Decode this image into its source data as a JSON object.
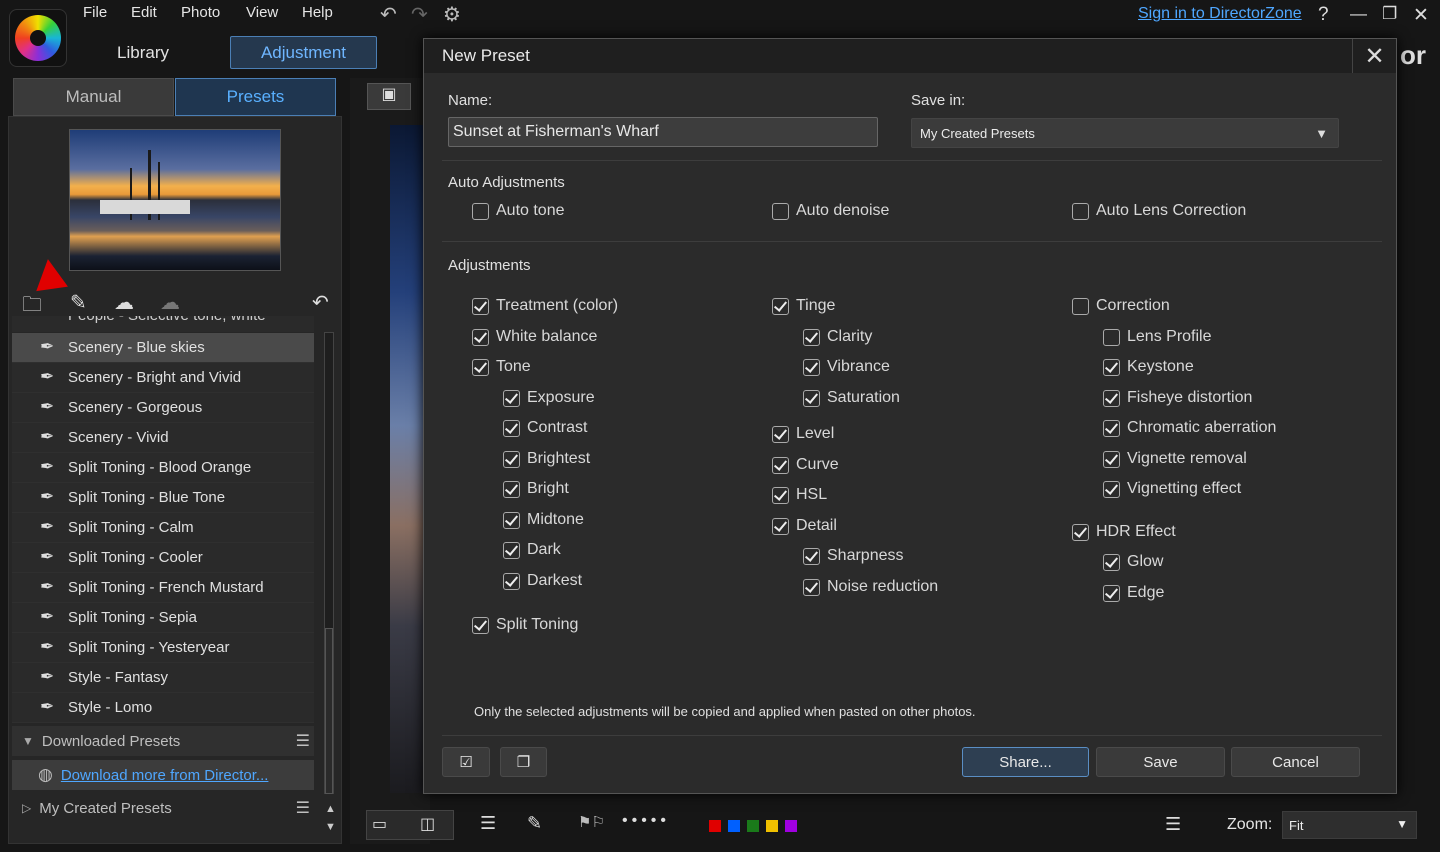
{
  "menu": {
    "items": [
      "File",
      "Edit",
      "Photo",
      "View",
      "Help"
    ]
  },
  "header": {
    "sign_in": "Sign in to DirectorZone",
    "library": "Library",
    "adjustment": "Adjustment",
    "help": "?"
  },
  "left_tabs": {
    "manual": "Manual",
    "presets": "Presets"
  },
  "presets": {
    "partial_item": "People - Selective tone, white",
    "items": [
      "Scenery - Blue skies",
      "Scenery - Bright and Vivid",
      "Scenery - Gorgeous",
      "Scenery - Vivid",
      "Split Toning - Blood Orange",
      "Split Toning - Blue Tone",
      "Split Toning - Calm",
      "Split Toning - Cooler",
      "Split Toning - French Mustard",
      "Split Toning - Sepia",
      "Split Toning - Yesteryear",
      "Style - Fantasy",
      "Style - Lomo"
    ],
    "selected": "Scenery - Blue skies",
    "downloaded_section": "Downloaded Presets",
    "download_link": "Download more from Director...",
    "my_created_section": "My Created Presets"
  },
  "dialog": {
    "title": "New Preset",
    "name_label": "Name:",
    "name_value": "Sunset at Fisherman's Wharf",
    "save_in_label": "Save in:",
    "save_in_value": "My Created Presets",
    "auto_section": "Auto Adjustments",
    "auto": {
      "auto_tone": "Auto tone",
      "auto_denoise": "Auto denoise",
      "auto_lens": "Auto Lens Correction"
    },
    "adjustments_section": "Adjustments",
    "col1": {
      "treatment": "Treatment (color)",
      "white_balance": "White balance",
      "tone": "Tone",
      "exposure": "Exposure",
      "contrast": "Contrast",
      "brightest": "Brightest",
      "bright": "Bright",
      "midtone": "Midtone",
      "dark": "Dark",
      "darkest": "Darkest",
      "split_toning": "Split Toning"
    },
    "col2": {
      "tinge": "Tinge",
      "clarity": "Clarity",
      "vibrance": "Vibrance",
      "saturation": "Saturation",
      "level": "Level",
      "curve": "Curve",
      "hsl": "HSL",
      "detail": "Detail",
      "sharpness": "Sharpness",
      "noise": "Noise reduction"
    },
    "col3": {
      "correction": "Correction",
      "lens_profile": "Lens Profile",
      "keystone": "Keystone",
      "fisheye": "Fisheye distortion",
      "chromatic": "Chromatic aberration",
      "vignette_removal": "Vignette removal",
      "vignetting": "Vignetting effect",
      "hdr": "HDR Effect",
      "glow": "Glow",
      "edge": "Edge"
    },
    "note": "Only the selected adjustments will be copied and applied when pasted on other photos.",
    "share": "Share...",
    "save": "Save",
    "cancel": "Cancel"
  },
  "bottom": {
    "zoom_label": "Zoom:",
    "zoom_value": "Fit"
  },
  "colors": {
    "accent": "#4fa7ff",
    "labels": [
      "#e00000",
      "#0060ff",
      "#1a7a1a",
      "#f0c000",
      "#a000e0"
    ]
  }
}
